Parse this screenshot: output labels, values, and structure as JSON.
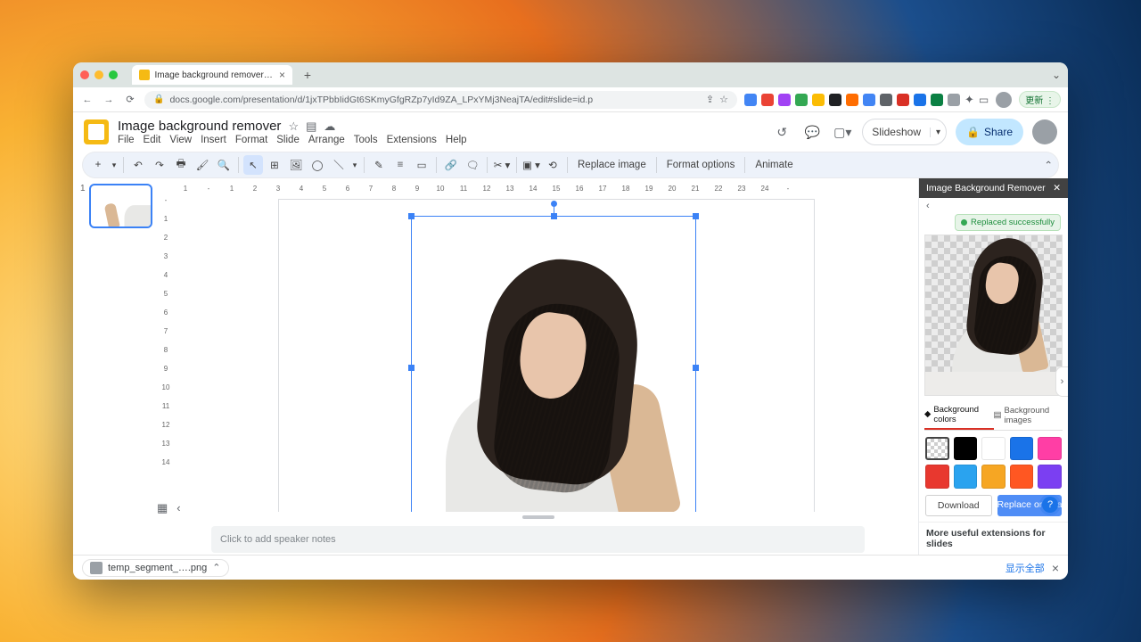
{
  "browser": {
    "tab_title": "Image background remover - G",
    "url": "docs.google.com/presentation/d/1jxTPbbIidGt6SKmyGfgRZp7yId9ZA_LPxYMj3NeajTA/edit#slide=id.p",
    "update_label": "更新"
  },
  "doc": {
    "title": "Image background remover",
    "menus": [
      "File",
      "Edit",
      "View",
      "Insert",
      "Format",
      "Slide",
      "Arrange",
      "Tools",
      "Extensions",
      "Help"
    ]
  },
  "header_buttons": {
    "slideshow": "Slideshow",
    "share": "Share"
  },
  "toolbar": {
    "replace_image": "Replace image",
    "format_options": "Format options",
    "animate": "Animate"
  },
  "ruler_h": [
    "1",
    "-",
    "1",
    "2",
    "3",
    "4",
    "5",
    "6",
    "7",
    "8",
    "9",
    "10",
    "11",
    "12",
    "13",
    "14",
    "15",
    "16",
    "17",
    "18",
    "19",
    "20",
    "21",
    "22",
    "23",
    "24",
    "-"
  ],
  "ruler_v": [
    "-",
    "1",
    "2",
    "3",
    "4",
    "5",
    "6",
    "7",
    "8",
    "9",
    "10",
    "11",
    "12",
    "13",
    "14"
  ],
  "filmstrip": {
    "slide_number": "1"
  },
  "notes_placeholder": "Click to add speaker notes",
  "extension": {
    "title": "Image Background Remover",
    "toast": "Replaced successfully",
    "tab_colors": "Background colors",
    "tab_images": "Background images",
    "download": "Download",
    "replace": "Replace original image",
    "more": "More useful extensions for slides",
    "swatches": [
      "transparent",
      "#000000",
      "#ffffff",
      "#1a73e8",
      "#ff3ea5",
      "#e8382f",
      "#2aa3ef",
      "#f6a623",
      "#ff5722",
      "#7b3ff2"
    ]
  },
  "download_shelf": {
    "file": "temp_segment_….png",
    "show_all": "显示全部"
  }
}
